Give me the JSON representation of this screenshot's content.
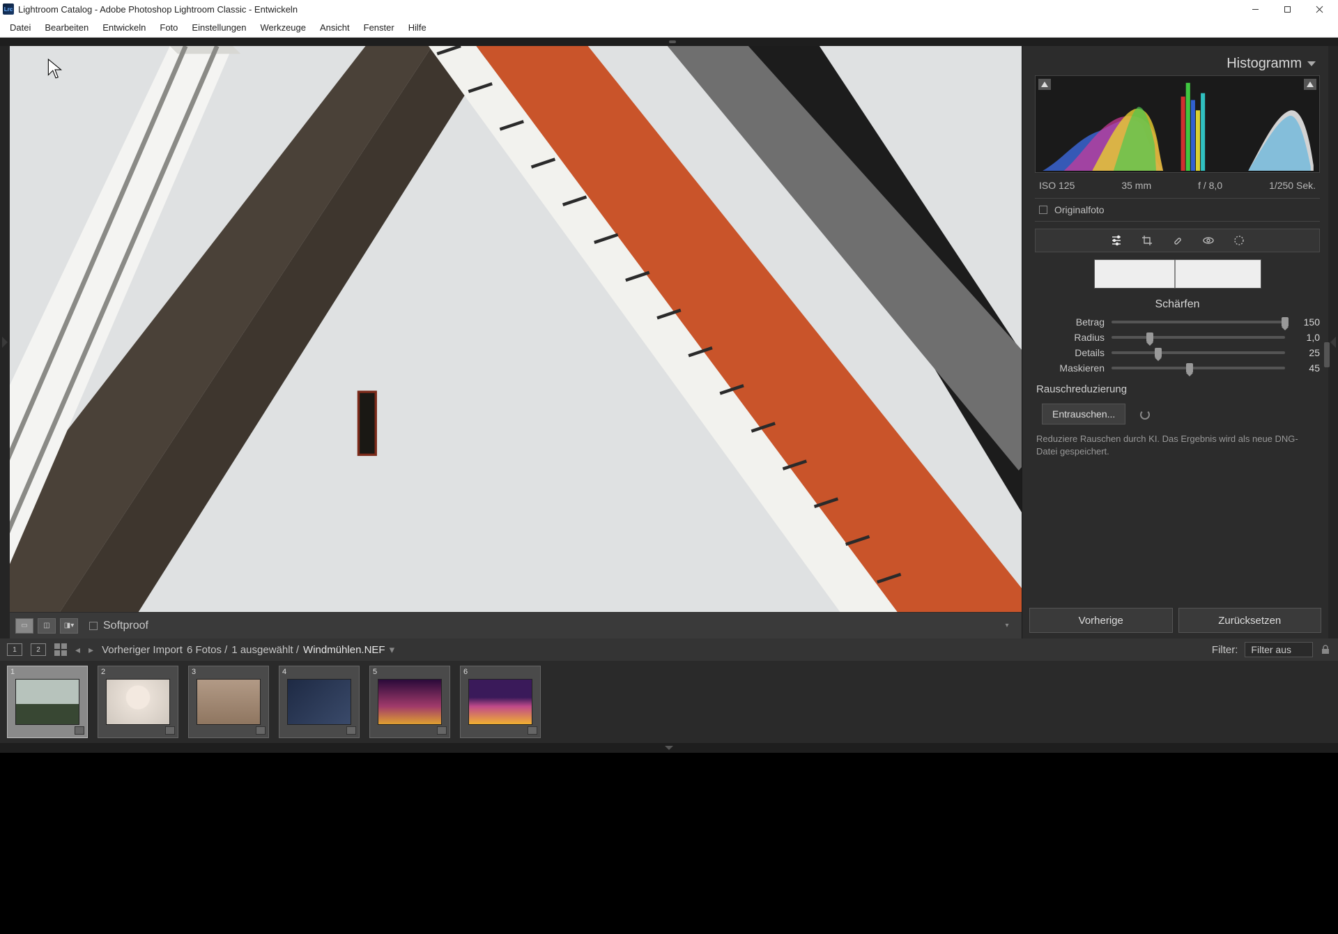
{
  "window": {
    "title": "Lightroom Catalog - Adobe Photoshop Lightroom Classic - Entwickeln",
    "app_icon_text": "Lrc"
  },
  "menu": {
    "items": [
      "Datei",
      "Bearbeiten",
      "Entwickeln",
      "Foto",
      "Einstellungen",
      "Werkzeuge",
      "Ansicht",
      "Fenster",
      "Hilfe"
    ]
  },
  "toolbar": {
    "softproof_label": "Softproof"
  },
  "right": {
    "histogram_title": "Histogramm",
    "exif": {
      "iso": "ISO 125",
      "focal": "35 mm",
      "aperture": "f / 8,0",
      "shutter": "1/250 Sek."
    },
    "original_label": "Originalfoto",
    "sharpen": {
      "title": "Schärfen",
      "rows": [
        {
          "label": "Betrag",
          "value": "150",
          "pos": 100
        },
        {
          "label": "Radius",
          "value": "1,0",
          "pos": 22
        },
        {
          "label": "Details",
          "value": "25",
          "pos": 27
        },
        {
          "label": "Maskieren",
          "value": "45",
          "pos": 45
        }
      ]
    },
    "noise": {
      "title": "Rauschreduzierung",
      "button": "Entrauschen...",
      "help": "Reduziere Rauschen durch KI. Das Ergebnis wird als neue DNG-Datei gespeichert."
    },
    "prev_button": "Vorherige",
    "reset_button": "Zurücksetzen"
  },
  "filmstrip": {
    "monitor1": "1",
    "monitor2": "2",
    "crumb_import": "Vorheriger Import",
    "crumb_count": "6 Fotos /",
    "crumb_selected": "1 ausgewählt /",
    "crumb_filename": "Windmühlen.NEF",
    "filter_label": "Filter:",
    "filter_value": "Filter aus",
    "thumbs": [
      {
        "idx": "1",
        "cls": "t1",
        "sel": true
      },
      {
        "idx": "2",
        "cls": "t2",
        "sel": false
      },
      {
        "idx": "3",
        "cls": "t3",
        "sel": false
      },
      {
        "idx": "4",
        "cls": "t4",
        "sel": false
      },
      {
        "idx": "5",
        "cls": "t5",
        "sel": false
      },
      {
        "idx": "6",
        "cls": "t6",
        "sel": false
      }
    ]
  }
}
